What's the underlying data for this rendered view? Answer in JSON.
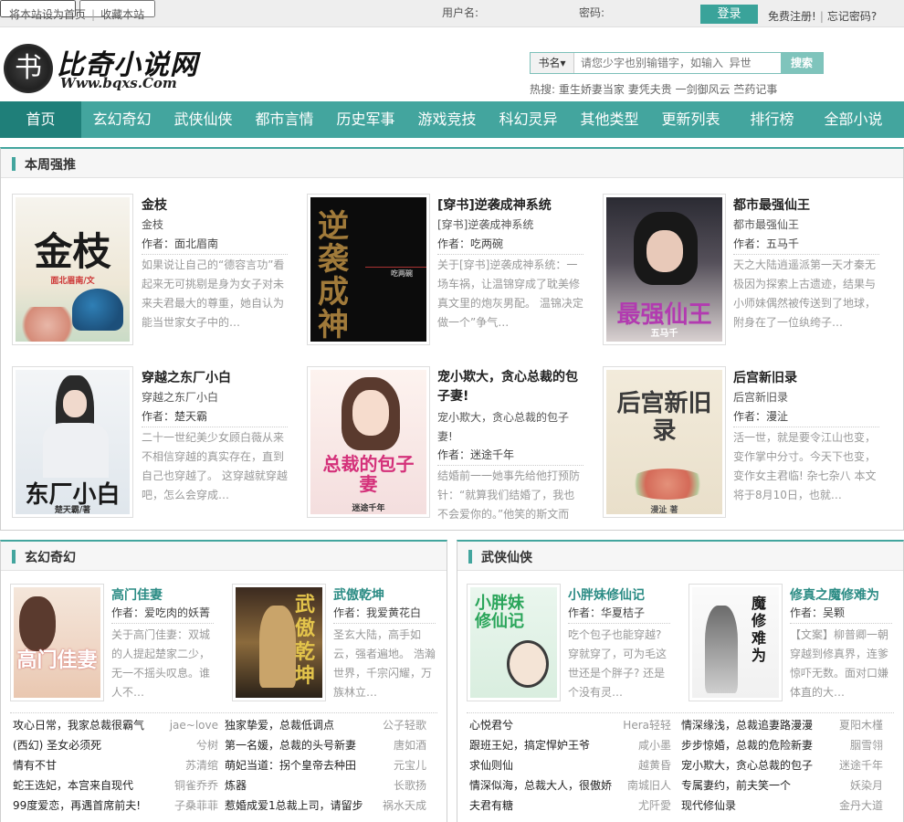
{
  "topbar": {
    "set_home": "将本站设为首页",
    "sep": "|",
    "bookmark": "收藏本站",
    "username_label": "用户名:",
    "password_label": "密码:",
    "login_button": "登录",
    "register": "免费注册!",
    "forgot": "忘记密码?"
  },
  "logo": {
    "name": "比奇小说网",
    "url": "Www.bqxs.Com",
    "seal_char": "书"
  },
  "search": {
    "select": "书名▾",
    "placeholder": "请您少字也别输错字，如输入  异世",
    "button": "搜索",
    "hot_label": "热搜:",
    "hot_words": [
      "重生娇妻当家",
      "妻凭夫贵",
      "一剑御风云",
      "苎药记事"
    ]
  },
  "nav": [
    "首页",
    "玄幻奇幻",
    "武侠仙侠",
    "都市言情",
    "历史军事",
    "游戏竞技",
    "科幻灵异",
    "其他类型",
    "更新列表",
    "排行榜",
    "全部小说"
  ],
  "weekly": {
    "title": "本周强推",
    "books": [
      {
        "title": "金枝",
        "sub": "金枝",
        "author": "作者：面北眉南",
        "desc": "如果说让自己的“德容言功”看起来无可挑剔是身为女子对未来夫君最大的尊重，她自认为能当世家女子中的…",
        "cover_text": "金枝",
        "cover_sub": "面北眉南/文"
      },
      {
        "title": "[穿书]逆袭成神系统",
        "sub": "[穿书]逆袭成神系统",
        "author": "作者：吃两碗",
        "desc": "关于[穿书]逆袭成神系统：一场车祸，让温锦穿成了耽美修真文里的炮灰男配。 温锦决定做一个”争气…",
        "cover_text": "逆袭成神",
        "cover_sub": "吃两碗"
      },
      {
        "title": "都市最强仙王",
        "sub": "都市最强仙王",
        "author": "作者：五马千",
        "desc": "天之大陆逍遥派第一天才秦无极因为探索上古遗迹，结果与小师妹偶然被传送到了地球，附身在了一位纨绔子…",
        "cover_text": "最强仙王",
        "cover_sub": "五马千"
      },
      {
        "title": "穿越之东厂小白",
        "sub": "穿越之东厂小白",
        "author": "作者：楚天霸",
        "desc": "二十一世纪美少女顾白薇从来不相信穿越的真实存在，直到自己也穿越了。 这穿越就穿越吧，怎么会穿成…",
        "cover_text": "东厂小白",
        "cover_sub": "楚天霸/著"
      },
      {
        "title": "宠小欺大，贪心总裁的包子妻!",
        "sub": "宠小欺大，贪心总裁的包子妻!",
        "author": "作者：迷途千年",
        "desc": "结婚前一一她事先给他打预防针：“就算我们结婚了，我也不会爱你的。”他笑的斯文而",
        "cover_text": "总裁的包子妻",
        "cover_sub": "迷途千年"
      },
      {
        "title": "后宫新旧录",
        "sub": "后宫新旧录",
        "author": "作者：漫沚",
        "desc": "活一世，就是要令江山也变，变作掌中分寸。今天下也变，变作女主君临! 杂七杂八 本文将于8月10日，也就…",
        "cover_text": "后宫新旧录",
        "cover_sub": "漫沚 著"
      }
    ]
  },
  "xuanhuan": {
    "title": "玄幻奇幻",
    "books": [
      {
        "title": "高门佳妻",
        "author": "作者：爱吃肉的妖菁",
        "desc": "关于高门佳妻：双城的人提起楚家二少，无一不摇头叹息。谁人不…",
        "cover_text": "高门佳妻"
      },
      {
        "title": "武傲乾坤",
        "author": "作者：我爱黄花白",
        "desc": "圣玄大陆，高手如云，强者遍地。 浩瀚世界，千宗闪耀，万族林立…",
        "cover_text": "武傲乾坤"
      }
    ],
    "list": [
      {
        "name": "攻心日常，我家总裁很霸气",
        "author": "jae~love"
      },
      {
        "name": "独家挚爱，总裁低调点",
        "author": "公子轻歌"
      },
      {
        "name": "(西幻) 圣女必须死",
        "author": "兮树"
      },
      {
        "name": "第一名媛，总裁的头号新妻",
        "author": "唐如酒"
      },
      {
        "name": "情有不甘",
        "author": "苏清绾"
      },
      {
        "name": "萌妃当道：拐个皇帝去种田",
        "author": "元宝儿"
      },
      {
        "name": "蛇王选妃，本宫来自现代",
        "author": "铜雀乔乔"
      },
      {
        "name": "炼器",
        "author": "长歌扬"
      },
      {
        "name": "99度爱恋，再遇首席前夫!",
        "author": "子桑菲菲"
      },
      {
        "name": "惹婚成爱1总裁上司，请留步",
        "author": "祸水天成"
      }
    ]
  },
  "wuxia": {
    "title": "武侠仙侠",
    "books": [
      {
        "title": "小胖妹修仙记",
        "author": "作者：华夏桔子",
        "desc": "吃个包子也能穿越? 穿就穿了，可为毛这世还是个胖子? 还是个没有灵…",
        "cover_text": "小胖妹修仙记"
      },
      {
        "title": "修真之魔修难为",
        "author": "作者：吴颗",
        "desc": "【文案】柳普卿一朝穿越到修真界，连爹惊吓无数。面对口嫌体直的大…",
        "cover_text": "魔修难为"
      }
    ],
    "list": [
      {
        "name": "心悦君兮",
        "author": "Hera轻轻"
      },
      {
        "name": "情深缘浅，总裁追妻路漫漫",
        "author": "夏阳木槿"
      },
      {
        "name": "跟班王妃，搞定悍妒王爷",
        "author": "咸小墨"
      },
      {
        "name": "步步惊婚，总裁的危险新妻",
        "author": "胭雪翎"
      },
      {
        "name": "求仙则仙",
        "author": "越黄昏"
      },
      {
        "name": "宠小欺大，贪心总裁的包子",
        "author": "迷途千年"
      },
      {
        "name": "情深似海，总裁大人，很傲娇",
        "author": "南城旧人"
      },
      {
        "name": "专属妻约，前夫笑一个",
        "author": "妖染月"
      },
      {
        "name": "夫君有糖",
        "author": "尤阡愛"
      },
      {
        "name": "现代修仙录",
        "author": "金丹大道"
      }
    ]
  },
  "colors": {
    "accent": "#43a59e",
    "accent_dark": "#1f7f79"
  }
}
